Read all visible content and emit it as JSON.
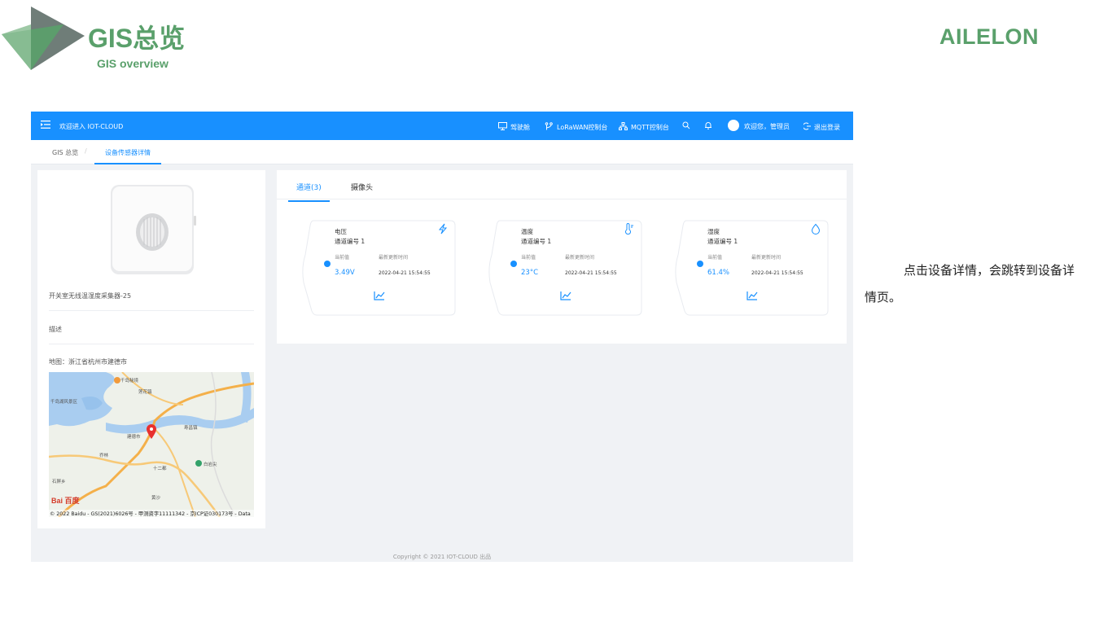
{
  "slide": {
    "title": "GIS总览",
    "subtitle": "GIS overview",
    "brand": "AILELON",
    "note": "点击设备详情，会跳转到设备详情页。",
    "colors": {
      "brand_green": "#5aa06b",
      "primary_blue": "#1890ff"
    }
  },
  "header": {
    "welcome": "欢迎进入 IOT-CLOUD",
    "items": [
      {
        "label": "驾驶舱",
        "icon": "monitor-icon"
      },
      {
        "label": "LoRaWAN控制台",
        "icon": "branch-icon"
      },
      {
        "label": "MQTT控制台",
        "icon": "network-icon"
      }
    ],
    "user_greeting": "欢迎您，管理员",
    "logout": "退出登录"
  },
  "tabs": [
    {
      "label": "GIS 总览"
    },
    {
      "label": "设备传感器详情",
      "active": true
    }
  ],
  "device": {
    "name": "开关室无线温湿度采集器-25",
    "description_label": "描述",
    "map_label": "地图：浙江省杭州市建德市",
    "map_credit": "© 2022 Baidu - GS(2021)6026号 - 甲测资字11111342 - 京ICP证030173号 - Data",
    "map_places": [
      "千岛秘境",
      "莲花镇",
      "千岛湖风景区",
      "建德市",
      "白岩尖",
      "十二都",
      "石屏乡",
      "黄沙",
      "寿昌镇",
      "乔林"
    ],
    "map_logo": "Bai 百度"
  },
  "panel": {
    "tabs": [
      {
        "label": "通道(3)",
        "active": true
      },
      {
        "label": "摄像头"
      }
    ],
    "channels": [
      {
        "name": "电压",
        "channel": "通道编号 1",
        "current_label": "当前值",
        "time_label": "最新更新时间",
        "value": "3.49V",
        "time": "2022-04-21 15:54:55",
        "icon": "lightning-icon"
      },
      {
        "name": "温度",
        "channel": "通道编号 1",
        "current_label": "当前值",
        "time_label": "最新更新时间",
        "value": "23°C",
        "time": "2022-04-21 15:54:55",
        "icon": "thermometer-icon"
      },
      {
        "name": "湿度",
        "channel": "通道编号 1",
        "current_label": "当前值",
        "time_label": "最新更新时间",
        "value": "61.4%",
        "time": "2022-04-21 15:54:55",
        "icon": "water-drop-icon"
      }
    ]
  },
  "footer": "Copyright © 2021 IOT-CLOUD 出品"
}
